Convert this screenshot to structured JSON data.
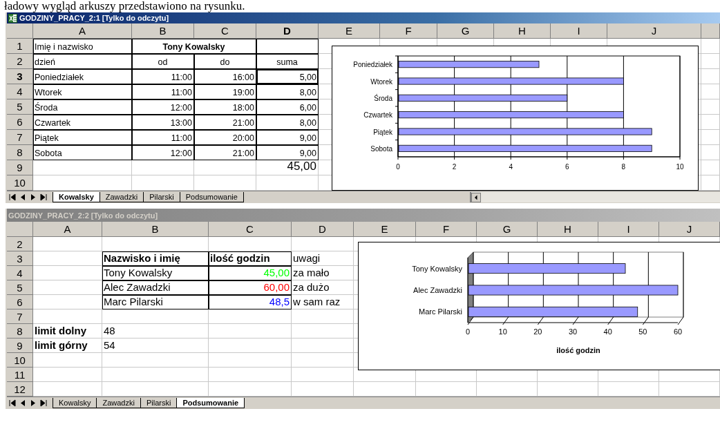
{
  "caption": "ładowy wygląd arkuszy przedstawiono na rysunku.",
  "windows": [
    {
      "title": "GODZINY_PRACY_2:1 [Tylko do odczytu]",
      "active": true,
      "columns": [
        {
          "label": "A",
          "selected": false
        },
        {
          "label": "B",
          "selected": false
        },
        {
          "label": "C",
          "selected": false
        },
        {
          "label": "D",
          "selected": true
        },
        {
          "label": "E",
          "selected": false
        },
        {
          "label": "F",
          "selected": false
        },
        {
          "label": "G",
          "selected": false
        },
        {
          "label": "H",
          "selected": false
        },
        {
          "label": "I",
          "selected": false
        },
        {
          "label": "J",
          "selected": false
        }
      ],
      "rows": [
        {
          "number": "1",
          "selected": false,
          "cells": [
            {
              "text": "Imię i nazwisko",
              "boxed": true
            },
            {
              "text": "Tony Kowalsky",
              "bold": true,
              "centered": true,
              "merged": true,
              "boxed": true
            },
            {
              "boxed": true
            }
          ]
        },
        {
          "number": "2",
          "selected": false,
          "cells": [
            {
              "text": "dzień",
              "boxed": true
            },
            {
              "text": "od",
              "centered": true,
              "boxed": true
            },
            {
              "text": "do",
              "centered": true,
              "boxed": true
            },
            {
              "text": "suma",
              "centered": true,
              "boxed": true
            }
          ]
        },
        {
          "number": "3",
          "selected": true,
          "cells": [
            {
              "text": "Poniedziałek",
              "boxed": true
            },
            {
              "text": "11:00",
              "right_aligned": true,
              "boxed": true
            },
            {
              "text": "16:00",
              "right_aligned": true,
              "boxed": true
            },
            {
              "text": "5,00",
              "right_aligned": true,
              "boxed": true
            }
          ]
        },
        {
          "number": "4",
          "selected": false,
          "cells": [
            {
              "text": "Wtorek",
              "boxed": true
            },
            {
              "text": "11:00",
              "right_aligned": true,
              "boxed": true
            },
            {
              "text": "19:00",
              "right_aligned": true,
              "boxed": true
            },
            {
              "text": "8,00",
              "right_aligned": true,
              "boxed": true
            }
          ]
        },
        {
          "number": "5",
          "selected": false,
          "cells": [
            {
              "text": "Środa",
              "boxed": true
            },
            {
              "text": "12:00",
              "right_aligned": true,
              "boxed": true
            },
            {
              "text": "18:00",
              "right_aligned": true,
              "boxed": true
            },
            {
              "text": "6,00",
              "right_aligned": true,
              "boxed": true
            }
          ]
        },
        {
          "number": "6",
          "selected": false,
          "cells": [
            {
              "text": "Czwartek",
              "boxed": true
            },
            {
              "text": "13:00",
              "right_aligned": true,
              "boxed": true
            },
            {
              "text": "21:00",
              "right_aligned": true,
              "boxed": true
            },
            {
              "text": "8,00",
              "right_aligned": true,
              "boxed": true
            }
          ]
        },
        {
          "number": "7",
          "selected": false,
          "cells": [
            {
              "text": "Piątek",
              "boxed": true
            },
            {
              "text": "11:00",
              "right_aligned": true,
              "boxed": true
            },
            {
              "text": "20:00",
              "right_aligned": true,
              "boxed": true
            },
            {
              "text": "9,00",
              "right_aligned": true,
              "boxed": true
            }
          ]
        },
        {
          "number": "8",
          "selected": false,
          "cells": [
            {
              "text": "Sobota",
              "boxed": true
            },
            {
              "text": "12:00",
              "right_aligned": true,
              "boxed": true
            },
            {
              "text": "21:00",
              "right_aligned": true,
              "boxed": true
            },
            {
              "text": "9,00",
              "right_aligned": true,
              "boxed": true
            }
          ]
        },
        {
          "number": "9",
          "selected": false,
          "cells": [
            {},
            {},
            {},
            {
              "text": "45,00",
              "right_aligned": true,
              "total": true
            }
          ]
        },
        {
          "number": "10",
          "selected": false,
          "cells": []
        }
      ],
      "chart": {
        "chart_data": {
          "type": "bar",
          "orientation": "horizontal",
          "categories": [
            "Poniedziałek",
            "Wtorek",
            "Środa",
            "Czwartek",
            "Piątek",
            "Sobota"
          ],
          "series": [
            {
              "color": "#9999ff",
              "values": [
                5,
                8,
                6,
                8,
                9,
                9
              ]
            }
          ],
          "grid": true,
          "xlim": [
            0,
            10
          ],
          "xticks": [
            0,
            2,
            4,
            6,
            8,
            10
          ]
        }
      },
      "sheet_tabs": [
        {
          "label": "Kowalsky",
          "selected": true
        },
        {
          "label": "Zawadzki",
          "selected": false
        },
        {
          "label": "Pilarski",
          "selected": false
        },
        {
          "label": "Podsumowanie",
          "selected": false
        }
      ]
    },
    {
      "title": "GODZINY_PRACY_2:2 [Tylko do odczytu]",
      "active": false,
      "columns": [
        {
          "label": "A",
          "selected": false
        },
        {
          "label": "B",
          "selected": false
        },
        {
          "label": "C",
          "selected": false
        },
        {
          "label": "D",
          "selected": false
        },
        {
          "label": "E",
          "selected": false
        },
        {
          "label": "F",
          "selected": false
        },
        {
          "label": "G",
          "selected": false
        },
        {
          "label": "H",
          "selected": false
        },
        {
          "label": "I",
          "selected": false
        },
        {
          "label": "J",
          "selected": false
        }
      ],
      "rows": [
        {
          "number": "2",
          "selected": false,
          "cells": []
        },
        {
          "number": "3",
          "selected": false,
          "cells": [
            {},
            {
              "text": "Nazwisko i imię",
              "bold": true,
              "boxed": true
            },
            {
              "text": "ilość godzin",
              "bold": true,
              "boxed": true
            },
            {
              "text": "uwagi"
            }
          ]
        },
        {
          "number": "4",
          "selected": false,
          "cells": [
            {},
            {
              "text": "Tony Kowalsky",
              "boxed": true
            },
            {
              "text": "45,00",
              "right_aligned": true,
              "boxed": true,
              "color": "#00ff00"
            },
            {
              "text": "za mało"
            }
          ]
        },
        {
          "number": "5",
          "selected": false,
          "cells": [
            {},
            {
              "text": "Alec Zawadzki",
              "boxed": true
            },
            {
              "text": "60,00",
              "right_aligned": true,
              "boxed": true,
              "color": "#ff0000"
            },
            {
              "text": "za dużo"
            }
          ]
        },
        {
          "number": "6",
          "selected": false,
          "cells": [
            {},
            {
              "text": "Marc Pilarski",
              "boxed": true
            },
            {
              "text": "48,5",
              "right_aligned": true,
              "boxed": true,
              "color": "#0000ff"
            },
            {
              "text": "w sam raz"
            }
          ]
        },
        {
          "number": "7",
          "selected": false,
          "cells": []
        },
        {
          "number": "8",
          "selected": false,
          "cells": [
            {
              "text": "limit dolny",
              "bold": true
            },
            {
              "text": "48"
            }
          ]
        },
        {
          "number": "9",
          "selected": false,
          "cells": [
            {
              "text": "limit górny",
              "bold": true
            },
            {
              "text": "54"
            }
          ]
        },
        {
          "number": "10",
          "selected": false,
          "cells": []
        },
        {
          "number": "11",
          "selected": false,
          "cells": []
        },
        {
          "number": "12",
          "selected": false,
          "cells": []
        }
      ],
      "chart": {
        "chart_data": {
          "type": "bar",
          "orientation": "horizontal",
          "xlabel": "ilość godzin",
          "categories": [
            "Tony Kowalsky",
            "Alec Zawadzki",
            "Marc Pilarski"
          ],
          "series": [
            {
              "color": "#9999ff",
              "values": [
                45,
                60,
                48.5
              ]
            }
          ],
          "grid": true,
          "xlim": [
            0,
            60
          ],
          "xticks": [
            0,
            10,
            20,
            30,
            40,
            50,
            60
          ]
        }
      },
      "sheet_tabs": [
        {
          "label": "Kowalsky",
          "selected": false
        },
        {
          "label": "Zawadzki",
          "selected": false
        },
        {
          "label": "Pilarski",
          "selected": false
        },
        {
          "label": "Podsumowanie",
          "selected": true
        }
      ]
    }
  ]
}
